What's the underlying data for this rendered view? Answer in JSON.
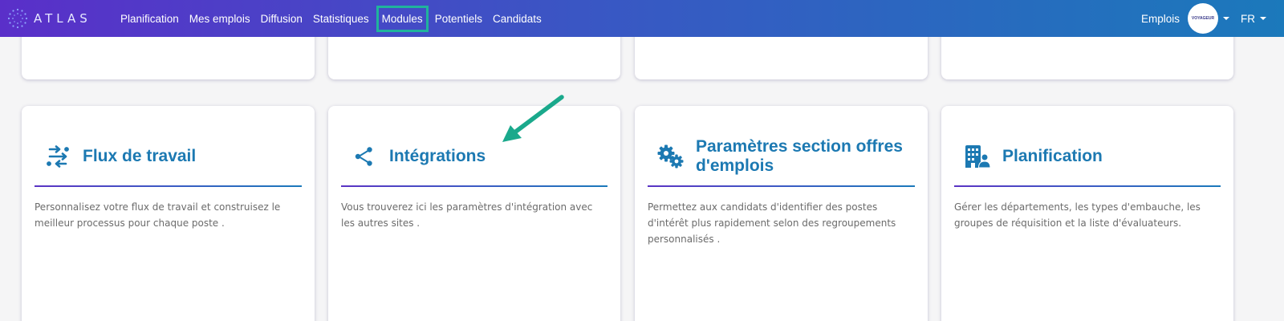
{
  "app": {
    "logo_text": "ATLAS",
    "logo_icon": "dotted-circle-logo",
    "accent_color": "#1c79b2",
    "highlight_color": "#20b39c"
  },
  "nav": {
    "items": [
      {
        "label": "Planification"
      },
      {
        "label": "Mes emplois"
      },
      {
        "label": "Diffusion"
      },
      {
        "label": "Statistiques"
      },
      {
        "label": "Modules",
        "active": true
      },
      {
        "label": "Potentiels"
      },
      {
        "label": "Candidats"
      }
    ],
    "right": {
      "emplois_label": "Emplois",
      "avatar_text": "VOYAGEUR",
      "language": "FR"
    }
  },
  "cards": [
    {
      "title": "Flux de travail",
      "icon": "workflow-arrows-icon",
      "description": "Personnalisez votre flux de travail et construisez le meilleur processus pour chaque poste ."
    },
    {
      "title": "Intégrations",
      "icon": "share-nodes-icon",
      "description": "Vous trouverez ici les paramètres d'intégration avec les autres sites ."
    },
    {
      "title": "Paramètres section offres d'emplois",
      "icon": "gears-icon",
      "description": "Permettez aux candidats d'identifier des postes d'intérêt plus rapidement selon des regroupements personnalisés ."
    },
    {
      "title": "Planification",
      "icon": "building-user-icon",
      "description": "Gérer les départements, les types d'embauche, les groupes de réquisition et la liste d'évaluateurs."
    }
  ]
}
